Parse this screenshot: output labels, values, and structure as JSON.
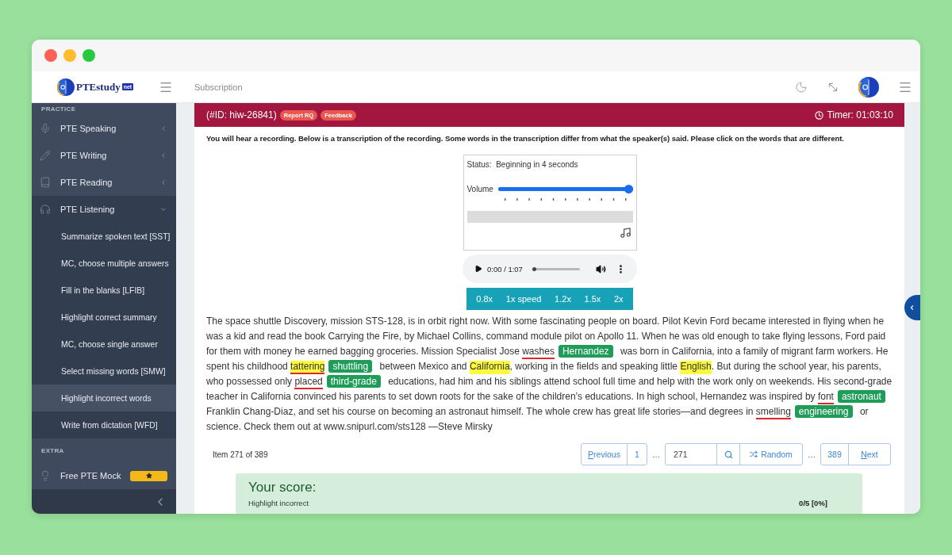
{
  "header": {
    "brand": {
      "name": "PTEstudy",
      "domain": "net"
    },
    "nav_link": "Subscription"
  },
  "sidebar": {
    "sections": [
      {
        "title": "PRACTICE",
        "items": [
          {
            "label": "PTE Speaking",
            "expanded": false
          },
          {
            "label": "PTE Writing",
            "expanded": false
          },
          {
            "label": "PTE Reading",
            "expanded": false
          },
          {
            "label": "PTE Listening",
            "expanded": true,
            "children": [
              {
                "label": "Summarize spoken text [SST]",
                "selected": false
              },
              {
                "label": "MC, choose multiple answers",
                "selected": false
              },
              {
                "label": "Fill in the blanks [LFIB]",
                "selected": false
              },
              {
                "label": "Highlight correct summary",
                "selected": false
              },
              {
                "label": "MC, choose single answer",
                "selected": false
              },
              {
                "label": "Select missing words [SMW]",
                "selected": false
              },
              {
                "label": "Highlight incorrect words",
                "selected": true
              },
              {
                "label": "Write from dictation [WFD]",
                "selected": false
              }
            ]
          }
        ]
      },
      {
        "title": "EXTRA",
        "items": [
          {
            "label": "Free PTE Mock",
            "starred": true
          }
        ]
      }
    ]
  },
  "question": {
    "id": "(#ID: hiw-26841)",
    "actions": [
      "Report RQ",
      "Feedback"
    ],
    "timer": "Timer: 01:03:10"
  },
  "instruction": "You will hear a recording. Below is a transcription of the recording. Some words in the transcription differ from what the speaker(s) said. Please click on the words that are different.",
  "player": {
    "status_label": "Status:",
    "status": "Beginning in 4 seconds",
    "volume_label": "Volume",
    "volume": {
      "level": 1
    },
    "audio": {
      "time": "0:00 / 1:07",
      "seek": {
        "level": 0
      }
    },
    "speeds": [
      "0.8x",
      "1x speed",
      "1.2x",
      "1.5x",
      "2x"
    ]
  },
  "passage": [
    {
      "kind": "text",
      "text": "The space shuttle Discovery, mission STS-128, is in orbit right now. With some fascinating people on board. Pilot Kevin Ford became interested in flying when he was a kid and read the book Carrying the Fire, by Michael Collins, command module pilot on Apollo 11. When he was old enough to take flying lessons, Ford paid for them with money he earned bagging groceries. Mission Specialist Jose "
    },
    {
      "kind": "word",
      "text": "washes",
      "selected": false,
      "incorrect": true
    },
    {
      "kind": "answer",
      "text": "Hernandez"
    },
    {
      "kind": "text",
      "text": " was born in California, into a family of migrant farm workers. He spent his childhood "
    },
    {
      "kind": "word",
      "text": "tattering",
      "selected": true,
      "incorrect": true
    },
    {
      "kind": "answer",
      "text": "shuttling"
    },
    {
      "kind": "text",
      "text": " between Mexico and "
    },
    {
      "kind": "word",
      "text": "California",
      "selected": true,
      "incorrect": false
    },
    {
      "kind": "text",
      "text": ", working in the fields and speaking little "
    },
    {
      "kind": "word",
      "text": "English",
      "selected": true,
      "incorrect": false
    },
    {
      "kind": "text",
      "text": ". But during the school year, his parents, who possessed only "
    },
    {
      "kind": "word",
      "text": "placed",
      "selected": false,
      "incorrect": true
    },
    {
      "kind": "answer",
      "text": "third-grade"
    },
    {
      "kind": "text",
      "text": " educations, had him and his siblings attend school full time and help with the work only on weekends. His second-grade teacher in California convinced his parents to set down roots for the sake of the children’s educations. In high school, Hernandez was inspired by "
    },
    {
      "kind": "word",
      "text": "font",
      "selected": false,
      "incorrect": true
    },
    {
      "kind": "answer",
      "text": "astronaut"
    },
    {
      "kind": "text",
      "text": " Franklin Chang-Diaz, and set his course on becoming an astronaut himself. The whole crew has great life stories—and degrees in "
    },
    {
      "kind": "word",
      "text": "smelling",
      "selected": false,
      "incorrect": true
    },
    {
      "kind": "answer",
      "text": "engineering"
    },
    {
      "kind": "text",
      "text": " or science. Check them out at www.snipurl.com/sts128 —Steve Mirsky"
    }
  ],
  "pagination": {
    "summary": "Item 271 of 389",
    "previous": "Previous",
    "first_page": "1",
    "gaps": [
      "…",
      "…"
    ],
    "page_field": {
      "value": "271"
    },
    "random": "Random",
    "last_page": "389",
    "next": "Next"
  },
  "score": {
    "title": "Your score:",
    "rows": [
      {
        "label": "Highlight incorrect",
        "value": "0/5 [0%]"
      }
    ]
  }
}
